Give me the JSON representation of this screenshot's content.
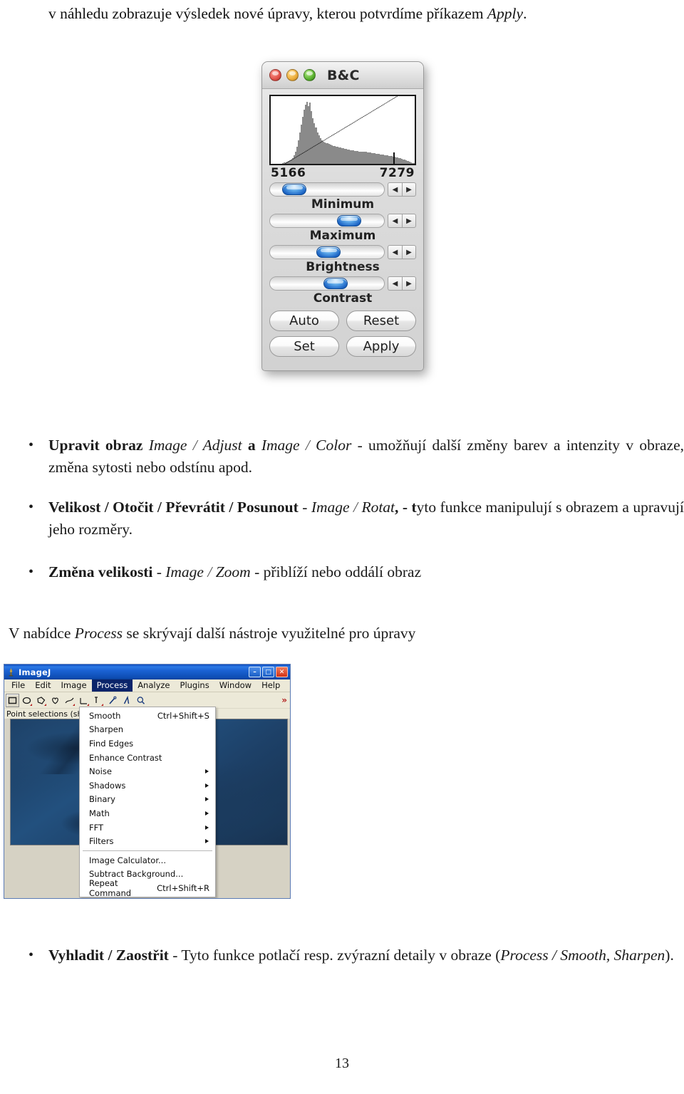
{
  "document": {
    "intro": {
      "part1": "v náhledu zobrazuje výsledek nové úpravy, kterou potvrdíme příkazem ",
      "apply": "Apply",
      "part2": "."
    },
    "bullets": [
      {
        "marker": "•",
        "segments": [
          {
            "text": "Upravit obraz ",
            "style": "bold"
          },
          {
            "text": "Image",
            "style": "italic"
          },
          {
            "text": " / ",
            "style": "italic-light"
          },
          {
            "text": "Adjust",
            "style": "italic"
          },
          {
            "text": " a ",
            "style": "bold"
          },
          {
            "text": "Image",
            "style": "italic"
          },
          {
            "text": " / ",
            "style": "italic-light"
          },
          {
            "text": "Color",
            "style": "italic"
          },
          {
            "text": " - umožňují další změny barev a intenzity v obraze, změna sytosti nebo odstínu apod.",
            "style": "normal"
          }
        ]
      },
      {
        "marker": "•",
        "segments": [
          {
            "text": "Velikost / Otočit / Převrátit / Posunout",
            "style": "bold"
          },
          {
            "text": " - ",
            "style": "normal"
          },
          {
            "text": "Image",
            "style": "italic"
          },
          {
            "text": " / ",
            "style": "italic-light"
          },
          {
            "text": "Rotat",
            "style": "italic"
          },
          {
            "text": ", - t",
            "style": "bold"
          },
          {
            "text": "yto funkce manipulují s obrazem a upravují jeho rozměry.",
            "style": "normal"
          }
        ]
      },
      {
        "marker": "•",
        "segments": [
          {
            "text": "Změna velikosti",
            "style": "bold"
          },
          {
            "text": " - ",
            "style": "normal"
          },
          {
            "text": "Image",
            "style": "italic"
          },
          {
            "text": " / ",
            "style": "italic-light"
          },
          {
            "text": "Zoom",
            "style": "italic"
          },
          {
            "text": " - přiblíží nebo oddálí obraz",
            "style": "normal"
          }
        ]
      }
    ],
    "paragraph": {
      "part1": "V nabídce ",
      "italic": "Process",
      "part2": " se skrývají další nástroje využitelné pro úpravy"
    },
    "final_bullet": {
      "marker": "•",
      "bold": "Vyhladit / Zaostřit",
      "normal1": " - Tyto funkce potlačí resp. zvýrazní detaily v obraze (",
      "italic1": "Process / Smooth, Sharpen",
      "normal2": ")."
    },
    "page_number": "13"
  },
  "bc_dialog": {
    "title": "B&C",
    "traffic_lights": [
      {
        "name": "close-button",
        "color": "#e2544b"
      },
      {
        "name": "minimize-button",
        "color": "#edae3c"
      },
      {
        "name": "zoom-button",
        "color": "#5cb331"
      }
    ],
    "histogram": {
      "min_label": "5166",
      "max_label": "7279",
      "marker_position_pct": 85,
      "line_start_pct": 10,
      "line_end_pct": 88,
      "bars": [
        0,
        0,
        0,
        0,
        0,
        0,
        0,
        0,
        1,
        2,
        2,
        3,
        4,
        5,
        7,
        9,
        13,
        18,
        26,
        36,
        48,
        60,
        72,
        83,
        90,
        95,
        88,
        94,
        80,
        70,
        62,
        55,
        48,
        43,
        39,
        36,
        34,
        33,
        32,
        31,
        30,
        29,
        28,
        27,
        27,
        26,
        26,
        25,
        25,
        24,
        24,
        23,
        23,
        22,
        22,
        21,
        21,
        21,
        20,
        20,
        20,
        19,
        19,
        19,
        18,
        18,
        18,
        17,
        17,
        17,
        16,
        16,
        16,
        15,
        15,
        15,
        14,
        14,
        14,
        13,
        13,
        13,
        12,
        12,
        12,
        11,
        11,
        10,
        10,
        9,
        9,
        8,
        7,
        6,
        5,
        4,
        3,
        2,
        1,
        1
      ]
    },
    "sliders": [
      {
        "label": "Minimum",
        "knob_pct": 17
      },
      {
        "label": "Maximum",
        "knob_pct": 65
      },
      {
        "label": "Brightness",
        "knob_pct": 47
      },
      {
        "label": "Contrast",
        "knob_pct": 53
      }
    ],
    "arrow_left": "◀",
    "arrow_right": "▶",
    "buttons": [
      {
        "label": "Auto"
      },
      {
        "label": "Reset"
      },
      {
        "label": "Set"
      },
      {
        "label": "Apply"
      }
    ]
  },
  "imagej": {
    "title": "ImageJ",
    "window_buttons": [
      {
        "name": "minimize-button",
        "glyph": "–"
      },
      {
        "name": "maximize-button",
        "glyph": "□"
      },
      {
        "name": "close-button",
        "glyph": "✕"
      }
    ],
    "menus": [
      {
        "label": "File",
        "active": false
      },
      {
        "label": "Edit",
        "active": false
      },
      {
        "label": "Image",
        "active": false
      },
      {
        "label": "Process",
        "active": true
      },
      {
        "label": "Analyze",
        "active": false
      },
      {
        "label": "Plugins",
        "active": false
      },
      {
        "label": "Window",
        "active": false
      },
      {
        "label": "Help",
        "active": false
      }
    ],
    "tools": [
      {
        "name": "rectangle-tool",
        "selected": true
      },
      {
        "name": "oval-tool",
        "selected": false
      },
      {
        "name": "polygon-tool",
        "selected": false
      },
      {
        "name": "freehand-tool",
        "selected": false
      },
      {
        "name": "line-tool",
        "selected": false
      },
      {
        "name": "angle-tool",
        "selected": false
      },
      {
        "name": "point-tool",
        "selected": false
      },
      {
        "name": "wand-tool",
        "selected": false
      },
      {
        "name": "text-tool",
        "selected": false
      },
      {
        "name": "magnifier-tool",
        "selected": false
      },
      {
        "name": "hand-tool",
        "selected": false
      },
      {
        "name": "dropper-tool",
        "selected": false
      }
    ],
    "more_tools_label": "»",
    "status_text": "Point selections (shift",
    "dropdown": {
      "items": [
        {
          "label": "Smooth",
          "accel": "Ctrl+Shift+S",
          "submenu": false,
          "separator_after": false
        },
        {
          "label": "Sharpen",
          "accel": "",
          "submenu": false,
          "separator_after": false
        },
        {
          "label": "Find Edges",
          "accel": "",
          "submenu": false,
          "separator_after": false
        },
        {
          "label": "Enhance Contrast",
          "accel": "",
          "submenu": false,
          "separator_after": false
        },
        {
          "label": "Noise",
          "accel": "",
          "submenu": true,
          "separator_after": false
        },
        {
          "label": "Shadows",
          "accel": "",
          "submenu": true,
          "separator_after": false
        },
        {
          "label": "Binary",
          "accel": "",
          "submenu": true,
          "separator_after": false
        },
        {
          "label": "Math",
          "accel": "",
          "submenu": true,
          "separator_after": false
        },
        {
          "label": "FFT",
          "accel": "",
          "submenu": true,
          "separator_after": false
        },
        {
          "label": "Filters",
          "accel": "",
          "submenu": true,
          "separator_after": true
        },
        {
          "label": "Image Calculator...",
          "accel": "",
          "submenu": false,
          "separator_after": false
        },
        {
          "label": "Subtract Background...",
          "accel": "",
          "submenu": false,
          "separator_after": false
        },
        {
          "label": "Repeat Command",
          "accel": "Ctrl+Shift+R",
          "submenu": false,
          "separator_after": false
        }
      ]
    }
  },
  "colors": {
    "menu_highlight": "#0a246a",
    "titlebar_blue": "#1a61d2",
    "canvas_navy": "#1d4067",
    "histogram_gray": "#8a8a8a",
    "knob_blue": "#1c63c4"
  }
}
